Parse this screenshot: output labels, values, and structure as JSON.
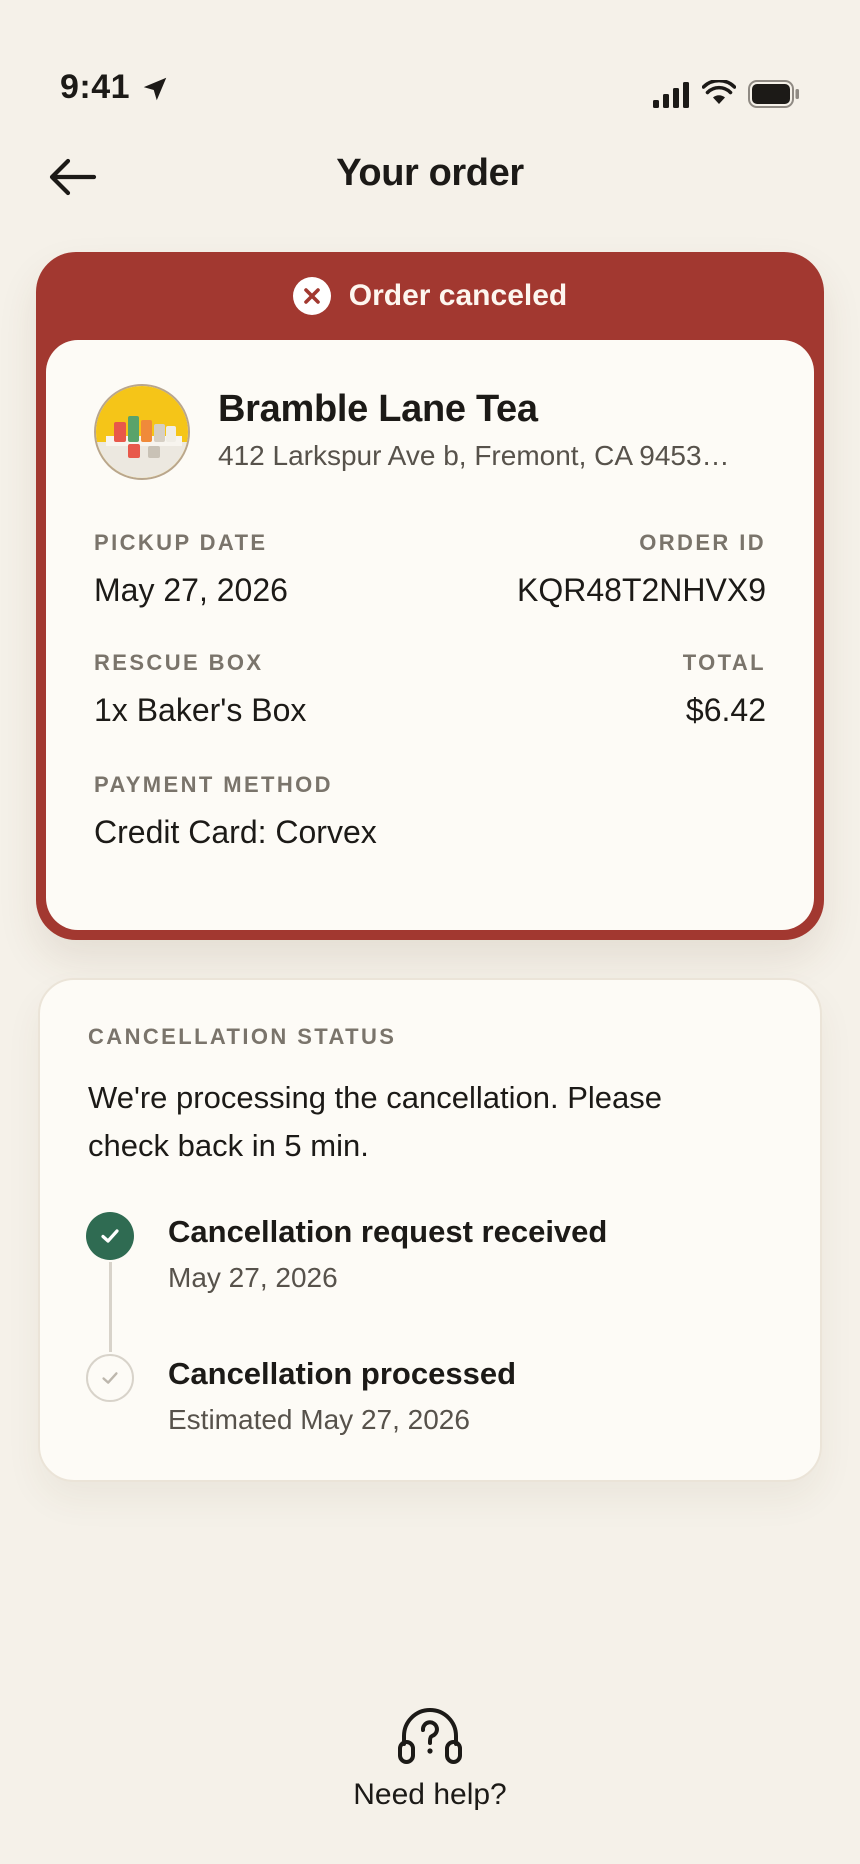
{
  "status_bar": {
    "time": "9:41",
    "icons": [
      "location-arrow-icon",
      "cellular-signal-icon",
      "wifi-icon",
      "battery-icon"
    ]
  },
  "header": {
    "title": "Your order",
    "back_icon": "arrow-left-icon"
  },
  "order": {
    "status_banner": "Order canceled",
    "banner_color": "#a23830",
    "store_name": "Bramble Lane Tea",
    "store_address": "412 Larkspur Ave b, Fremont, CA 9453…",
    "pickup_date_label": "PICKUP DATE",
    "pickup_date": "May 27, 2026",
    "order_id_label": "ORDER ID",
    "order_id": "KQR48T2NHVX9",
    "rescue_box_label": "RESCUE BOX",
    "rescue_box": "1x Baker's Box",
    "total_label": "TOTAL",
    "total": "$6.42",
    "payment_method_label": "PAYMENT METHOD",
    "payment_method": "Credit Card: Corvex"
  },
  "cancellation": {
    "label": "CANCELLATION STATUS",
    "message": "We're processing the cancellation. Please check back in 5 min.",
    "steps": [
      {
        "title": "Cancellation request received",
        "subtitle": "May 27, 2026",
        "state": "completed"
      },
      {
        "title": "Cancellation processed",
        "subtitle": "Estimated May 27, 2026",
        "state": "pending"
      }
    ],
    "completed_color": "#2f6b52"
  },
  "help": {
    "label": "Need help?",
    "icon": "headset-question-icon"
  }
}
